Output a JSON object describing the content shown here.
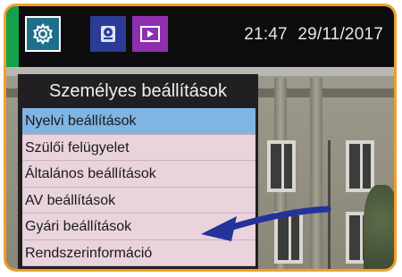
{
  "header": {
    "time": "21:47",
    "date": "29/11/2017"
  },
  "tabs": [
    {
      "icon": "gear-icon",
      "color": "#1d6f8a",
      "active": true
    },
    {
      "icon": "hard-drive-icon",
      "color": "#2a3c96",
      "active": false
    },
    {
      "icon": "play-icon",
      "color": "#8e2fb0",
      "active": false
    }
  ],
  "menu": {
    "title": "Személyes beállítások",
    "items": [
      {
        "label": "Nyelvi beállítások",
        "selected": true
      },
      {
        "label": "Szülői felügyelet"
      },
      {
        "label": "Általános beállítások"
      },
      {
        "label": "AV beállítások"
      },
      {
        "label": "Gyári beállítások"
      },
      {
        "label": "Rendszerinformáció"
      }
    ]
  },
  "colors": {
    "frame": "#f0a02a",
    "selected_item": "#7fb4e3",
    "menu_item": "#e9d3dc",
    "arrow": "#23339a"
  }
}
